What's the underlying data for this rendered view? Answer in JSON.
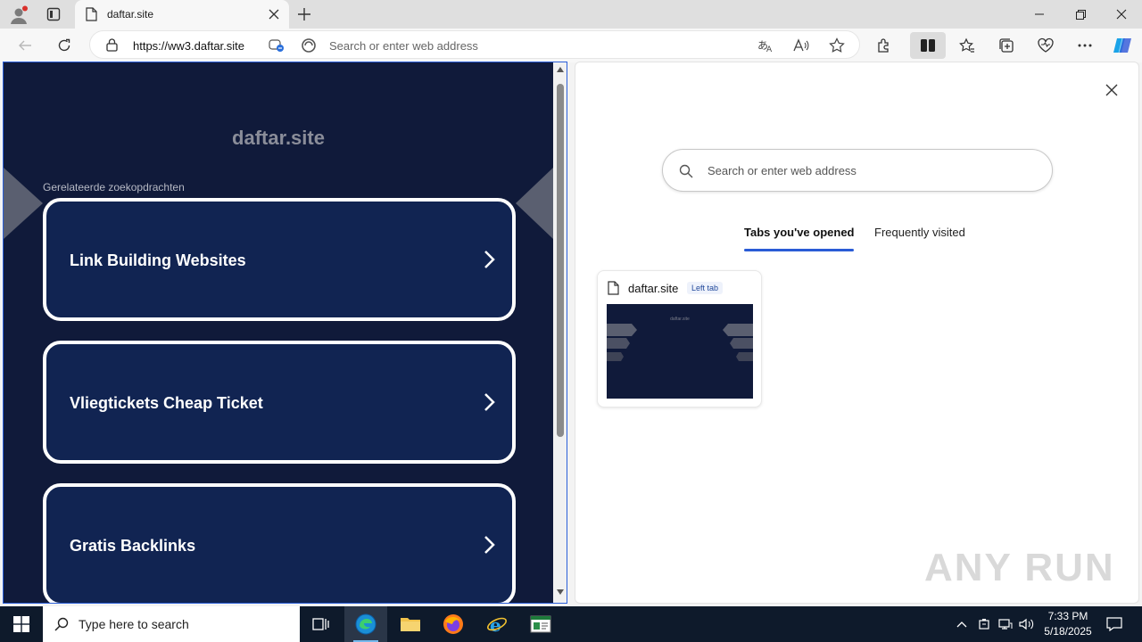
{
  "browser": {
    "tab_title": "daftar.site",
    "url": "https://ww3.daftar.site",
    "address_placeholder": "Search or enter web address"
  },
  "left_page": {
    "site_title": "daftar.site",
    "related_label": "Gerelateerde zoekopdrachten",
    "cards": [
      {
        "label": "Link Building Websites"
      },
      {
        "label": "Vliegtickets Cheap Ticket"
      },
      {
        "label": "Gratis Backlinks"
      }
    ]
  },
  "new_tab": {
    "search_placeholder": "Search or enter web address",
    "tabs": [
      {
        "label": "Tabs you've opened",
        "active": true
      },
      {
        "label": "Frequently visited",
        "active": false
      }
    ],
    "opened": [
      {
        "title": "daftar.site",
        "badge": "Left tab",
        "thumb_title": "daftar.site"
      }
    ]
  },
  "watermark": "ANY RUN",
  "taskbar": {
    "search_placeholder": "Type here to search",
    "time": "7:33 PM",
    "date": "5/18/2025"
  },
  "colors": {
    "page_bg": "#101a3a",
    "card_bg": "#112452",
    "accent": "#2a5cd6"
  }
}
